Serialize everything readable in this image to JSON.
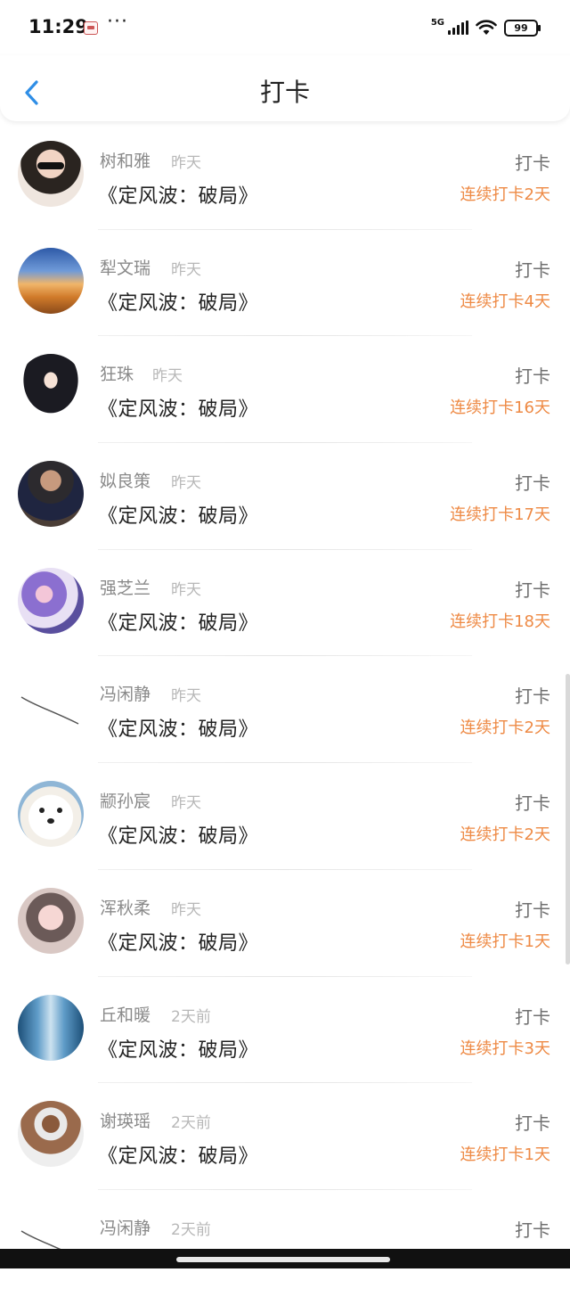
{
  "status_bar": {
    "time": "11:29",
    "more": "···",
    "network": "5G",
    "battery": "99"
  },
  "header": {
    "title": "打卡"
  },
  "entries": [
    {
      "name": "树和雅",
      "time": "昨天",
      "book": "《定风波：破局》",
      "action": "打卡",
      "streak": "连续打卡2天",
      "avatar": "photo-girl-sunglasses"
    },
    {
      "name": "犁文瑞",
      "time": "昨天",
      "book": "《定风波：破局》",
      "action": "打卡",
      "streak": "连续打卡4天",
      "avatar": "desert-landscape"
    },
    {
      "name": "狂珠",
      "time": "昨天",
      "book": "《定风波：破局》",
      "action": "打卡",
      "streak": "连续打卡16天",
      "avatar": "anime-girl"
    },
    {
      "name": "姒良策",
      "time": "昨天",
      "book": "《定风波：破局》",
      "action": "打卡",
      "streak": "连续打卡17天",
      "avatar": "man-in-suit"
    },
    {
      "name": "强芝兰",
      "time": "昨天",
      "book": "《定风波：破局》",
      "action": "打卡",
      "streak": "连续打卡18天",
      "avatar": "anime-purple-character"
    },
    {
      "name": "冯闲静",
      "time": "昨天",
      "book": "《定风波：破局》",
      "action": "打卡",
      "streak": "连续打卡2天",
      "avatar": "line-sketch"
    },
    {
      "name": "颛孙宸",
      "time": "昨天",
      "book": "《定风波：破局》",
      "action": "打卡",
      "streak": "连续打卡2天",
      "avatar": "white-dog"
    },
    {
      "name": "浑秋柔",
      "time": "昨天",
      "book": "《定风波：破局》",
      "action": "打卡",
      "streak": "连续打卡1天",
      "avatar": "illustrated-girl"
    },
    {
      "name": "丘和暖",
      "time": "2天前",
      "book": "《定风波：破局》",
      "action": "打卡",
      "streak": "连续打卡3天",
      "avatar": "glass-building"
    },
    {
      "name": "谢瑛瑶",
      "time": "2天前",
      "book": "《定风波：破局》",
      "action": "打卡",
      "streak": "连续打卡1天",
      "avatar": "fitness-man"
    },
    {
      "name": "冯闲静",
      "time": "2天前",
      "book": "",
      "action": "打卡",
      "streak": "",
      "avatar": "line-sketch"
    }
  ],
  "colors": {
    "accent_blue": "#2f8ee6",
    "streak_orange": "#ee8a45",
    "name_gray": "#8a8a8a",
    "time_gray": "#b8b8b8"
  }
}
